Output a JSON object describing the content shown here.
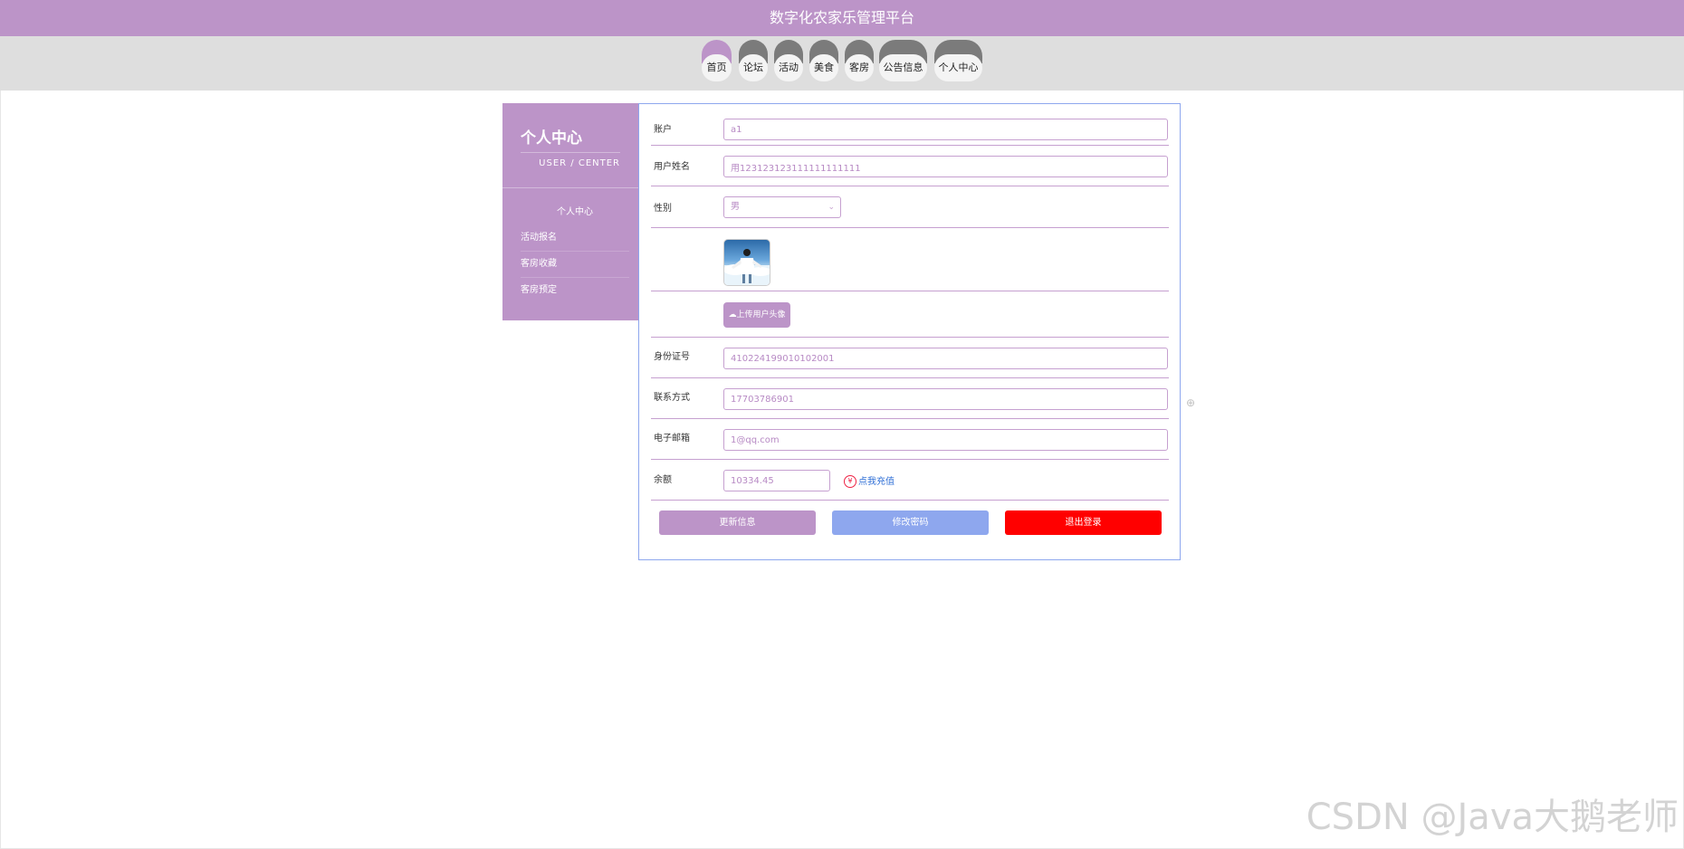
{
  "header": {
    "title": "数字化农家乐管理平台"
  },
  "nav": {
    "items": [
      {
        "label": "首页",
        "active": true
      },
      {
        "label": "论坛",
        "active": false
      },
      {
        "label": "活动",
        "active": false
      },
      {
        "label": "美食",
        "active": false
      },
      {
        "label": "客房",
        "active": false
      },
      {
        "label": "公告信息",
        "active": false
      },
      {
        "label": "个人中心",
        "active": false
      }
    ]
  },
  "sidebar": {
    "title": "个人中心",
    "subtitle": "USER / CENTER",
    "items": [
      {
        "label": "个人中心"
      },
      {
        "label": "活动报名"
      },
      {
        "label": "客房收藏"
      },
      {
        "label": "客房预定"
      }
    ]
  },
  "form": {
    "account": {
      "label": "账户",
      "value": "a1"
    },
    "name": {
      "label": "用户姓名",
      "value": "用123123123111111111111"
    },
    "gender": {
      "label": "性别",
      "value": "男"
    },
    "upload": {
      "label": "上传用户头像"
    },
    "id_card": {
      "label": "身份证号",
      "value": "410224199010102001"
    },
    "phone": {
      "label": "联系方式",
      "value": "17703786901"
    },
    "email": {
      "label": "电子邮箱",
      "value": "1@qq.com"
    },
    "balance": {
      "label": "余额",
      "value": "10334.45",
      "recharge": "点我充值",
      "currency_icon": "¥"
    }
  },
  "actions": {
    "update": "更新信息",
    "password": "修改密码",
    "logout": "退出登录"
  },
  "colors": {
    "primary": "#bc94c8",
    "secondary": "#8ea7ee",
    "danger": "#ff0000",
    "nav_dark": "#7b7b7b"
  },
  "watermark": "CSDN @Java大鹅老师"
}
